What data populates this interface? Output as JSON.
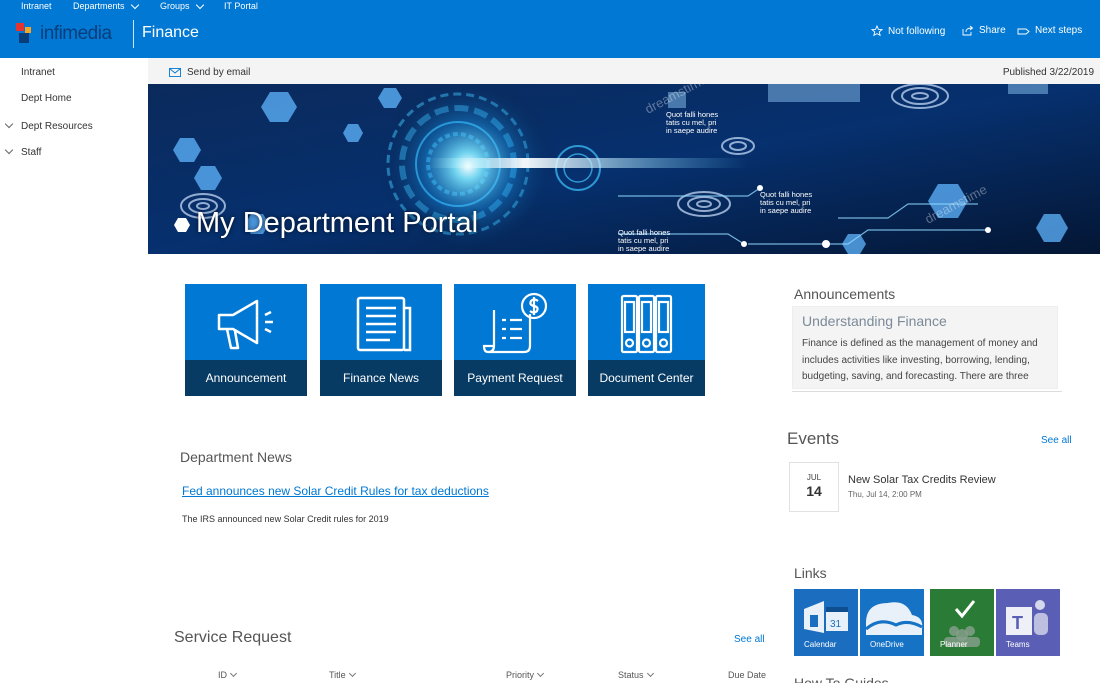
{
  "suite_nav": {
    "items": [
      {
        "label": "Intranet",
        "has_menu": false
      },
      {
        "label": "Departments",
        "has_menu": true
      },
      {
        "label": "Groups",
        "has_menu": true
      },
      {
        "label": "IT Portal",
        "has_menu": false
      }
    ]
  },
  "brand": {
    "logo_text": "infimedia",
    "site_title": "Finance",
    "colors": {
      "suite_bar": "#0078d4",
      "logo_text": "#0a3e7a"
    }
  },
  "header_actions": {
    "follow": {
      "label": "Not following",
      "icon": "star-outline-icon"
    },
    "share": {
      "label": "Share",
      "icon": "share-icon"
    },
    "next_steps": {
      "label": "Next steps",
      "icon": "next-steps-icon"
    }
  },
  "left_nav": {
    "items": [
      {
        "label": "Intranet",
        "expandable": false
      },
      {
        "label": "Dept Home",
        "expandable": false
      },
      {
        "label": "Dept Resources",
        "expandable": true
      },
      {
        "label": "Staff",
        "expandable": true
      }
    ]
  },
  "command_bar": {
    "send_email": {
      "label": "Send by email",
      "icon": "mail-icon"
    },
    "published": "Published 3/22/2019"
  },
  "hero": {
    "title": "My Department Portal",
    "overlay_texts": [
      {
        "lines": [
          "Quot falli hones",
          "tatis cu mel, pri",
          "in  saepe audire"
        ]
      },
      {
        "lines": [
          "Quot falli hones",
          "tatis cu mel, pri",
          "in  saepe audire"
        ]
      },
      {
        "lines": [
          "Quot falli hones",
          "tatis cu mel, pri",
          "in  saepe audire"
        ]
      }
    ],
    "watermark": "dreamstime"
  },
  "quick_links": [
    {
      "label": "Announcement",
      "icon": "megaphone-icon"
    },
    {
      "label": "Finance News",
      "icon": "newspaper-icon"
    },
    {
      "label": "Payment Request",
      "icon": "payment-receipt-icon"
    },
    {
      "label": "Document Center",
      "icon": "binders-icon"
    }
  ],
  "department_news": {
    "title": "Department News",
    "article": {
      "title": "Fed announces new Solar Credit Rules for tax deductions",
      "description": "The IRS announced new Solar Credit rules for 2019"
    }
  },
  "service_request": {
    "title": "Service Request",
    "see_all": "See all",
    "columns": [
      "ID",
      "Title",
      "Priority",
      "Status",
      "Due Date"
    ]
  },
  "announcements": {
    "title": "Announcements",
    "item": {
      "title": "Understanding Finance",
      "body": "Finance is defined as the management of money and includes activities like investing, borrowing, lending, budgeting, saving, and forecasting. There are three"
    }
  },
  "events": {
    "title": "Events",
    "see_all": "See all",
    "item": {
      "month": "JUL",
      "day": "14",
      "title": "New Solar Tax Credits Review",
      "time": "Thu, Jul 14, 2:00 PM"
    }
  },
  "links": {
    "title": "Links",
    "tiles": [
      {
        "label": "Calendar",
        "icon": "calendar-icon",
        "color": "#1b6dbf"
      },
      {
        "label": "OneDrive",
        "icon": "onedrive-cloud-icon",
        "color": "#1572c4"
      },
      {
        "label": "Planner",
        "icon": "planner-check-icon",
        "color": "#2a7b35"
      },
      {
        "label": "Teams",
        "icon": "teams-icon",
        "color": "#5a5fb5"
      }
    ]
  },
  "how_to_guides": {
    "title": "How To Guides"
  }
}
